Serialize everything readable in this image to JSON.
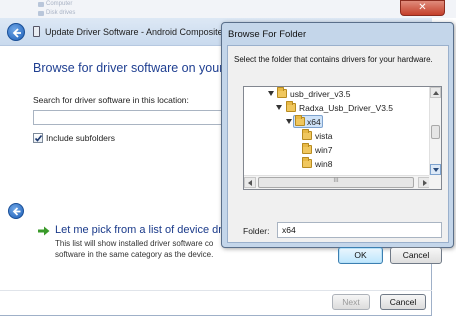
{
  "background": {
    "items": [
      "Computer",
      "Disk drives"
    ]
  },
  "window_close": {
    "glyph": "✕"
  },
  "wizard": {
    "title": "Update Driver Software - Android Composite AD",
    "heading": "Browse for driver software on your co",
    "location_label": "Search for driver software in this location:",
    "location_value": "",
    "include_subfolders_label": "Include subfolders",
    "include_subfolders_checked": true,
    "pick_link": "Let me pick from a list of device dr",
    "pick_desc": "This list will show installed driver software co software in the same category as the device.",
    "next_label": "Next",
    "cancel_label": "Cancel"
  },
  "dialog": {
    "title": "Browse For Folder",
    "instruction": "Select the folder that contains drivers for your hardware.",
    "tree": [
      {
        "label": "usb_driver_v3.5",
        "expanded": true,
        "selected": false
      },
      {
        "label": "Radxa_Usb_Driver_V3.5",
        "expanded": true,
        "selected": false
      },
      {
        "label": "x64",
        "expanded": true,
        "selected": true
      },
      {
        "label": "vista",
        "expanded": false,
        "selected": false
      },
      {
        "label": "win7",
        "expanded": false,
        "selected": false
      },
      {
        "label": "win8",
        "expanded": false,
        "selected": false
      }
    ],
    "hscroll_grip": "III",
    "folder_label": "Folder:",
    "folder_value": "x64",
    "ok_label": "OK",
    "cancel_label": "Cancel"
  }
}
